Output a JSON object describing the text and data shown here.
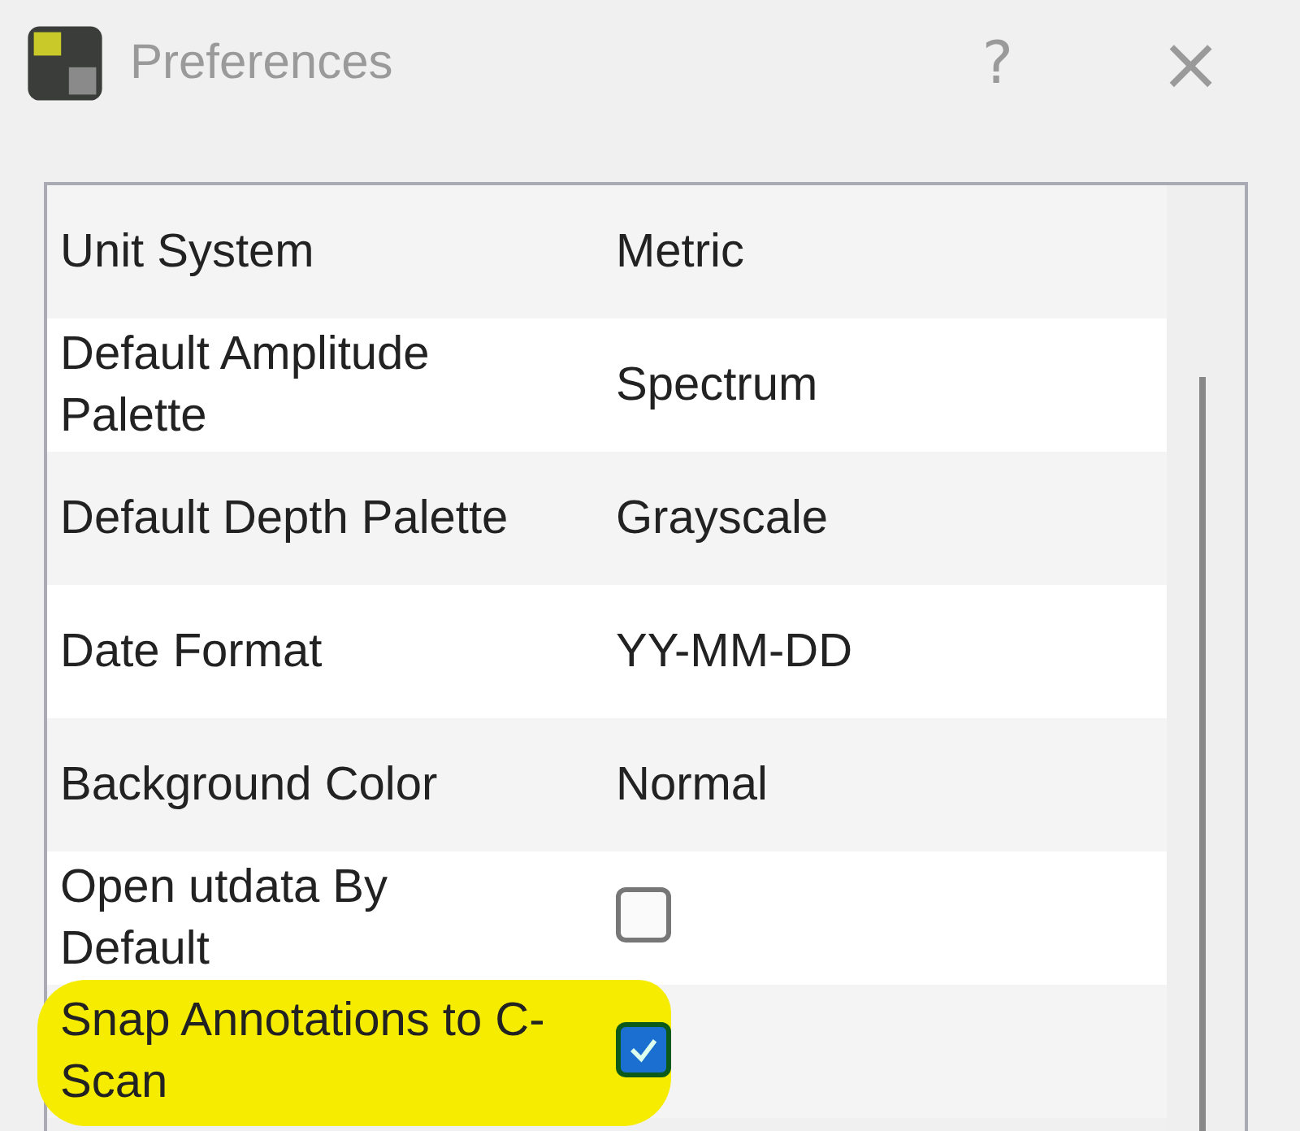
{
  "window": {
    "title": "Preferences",
    "help": "?",
    "close": "×"
  },
  "rows": [
    {
      "kind": "text",
      "label": "Unit System",
      "value": "Metric",
      "highlighted": false
    },
    {
      "kind": "text",
      "label": "Default Amplitude Palette",
      "value": "Spectrum",
      "highlighted": false
    },
    {
      "kind": "text",
      "label": "Default Depth Palette",
      "value": "Grayscale",
      "highlighted": false
    },
    {
      "kind": "text",
      "label": "Date Format",
      "value": "YY-MM-DD",
      "highlighted": false
    },
    {
      "kind": "text",
      "label": "Background Color",
      "value": "Normal",
      "highlighted": false
    },
    {
      "kind": "checkbox",
      "label": "Open utdata By Default",
      "checked": false,
      "highlighted": false
    },
    {
      "kind": "checkbox",
      "label": "Snap Annotations to C-Scan",
      "checked": true,
      "highlighted": true
    }
  ]
}
